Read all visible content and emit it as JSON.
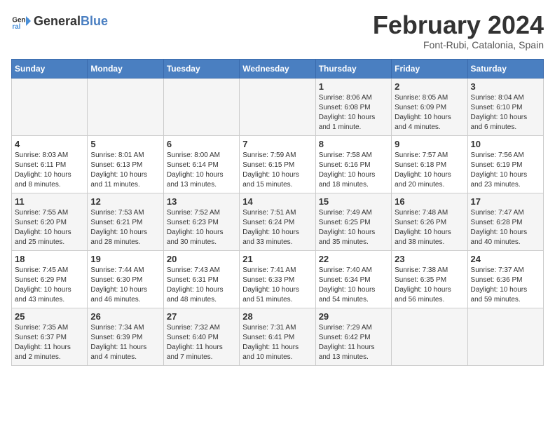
{
  "header": {
    "logo_general": "General",
    "logo_blue": "Blue",
    "title": "February 2024",
    "subtitle": "Font-Rubi, Catalonia, Spain"
  },
  "days_of_week": [
    "Sunday",
    "Monday",
    "Tuesday",
    "Wednesday",
    "Thursday",
    "Friday",
    "Saturday"
  ],
  "weeks": [
    [
      {
        "day": "",
        "detail": ""
      },
      {
        "day": "",
        "detail": ""
      },
      {
        "day": "",
        "detail": ""
      },
      {
        "day": "",
        "detail": ""
      },
      {
        "day": "1",
        "detail": "Sunrise: 8:06 AM\nSunset: 6:08 PM\nDaylight: 10 hours\nand 1 minute."
      },
      {
        "day": "2",
        "detail": "Sunrise: 8:05 AM\nSunset: 6:09 PM\nDaylight: 10 hours\nand 4 minutes."
      },
      {
        "day": "3",
        "detail": "Sunrise: 8:04 AM\nSunset: 6:10 PM\nDaylight: 10 hours\nand 6 minutes."
      }
    ],
    [
      {
        "day": "4",
        "detail": "Sunrise: 8:03 AM\nSunset: 6:11 PM\nDaylight: 10 hours\nand 8 minutes."
      },
      {
        "day": "5",
        "detail": "Sunrise: 8:01 AM\nSunset: 6:13 PM\nDaylight: 10 hours\nand 11 minutes."
      },
      {
        "day": "6",
        "detail": "Sunrise: 8:00 AM\nSunset: 6:14 PM\nDaylight: 10 hours\nand 13 minutes."
      },
      {
        "day": "7",
        "detail": "Sunrise: 7:59 AM\nSunset: 6:15 PM\nDaylight: 10 hours\nand 15 minutes."
      },
      {
        "day": "8",
        "detail": "Sunrise: 7:58 AM\nSunset: 6:16 PM\nDaylight: 10 hours\nand 18 minutes."
      },
      {
        "day": "9",
        "detail": "Sunrise: 7:57 AM\nSunset: 6:18 PM\nDaylight: 10 hours\nand 20 minutes."
      },
      {
        "day": "10",
        "detail": "Sunrise: 7:56 AM\nSunset: 6:19 PM\nDaylight: 10 hours\nand 23 minutes."
      }
    ],
    [
      {
        "day": "11",
        "detail": "Sunrise: 7:55 AM\nSunset: 6:20 PM\nDaylight: 10 hours\nand 25 minutes."
      },
      {
        "day": "12",
        "detail": "Sunrise: 7:53 AM\nSunset: 6:21 PM\nDaylight: 10 hours\nand 28 minutes."
      },
      {
        "day": "13",
        "detail": "Sunrise: 7:52 AM\nSunset: 6:23 PM\nDaylight: 10 hours\nand 30 minutes."
      },
      {
        "day": "14",
        "detail": "Sunrise: 7:51 AM\nSunset: 6:24 PM\nDaylight: 10 hours\nand 33 minutes."
      },
      {
        "day": "15",
        "detail": "Sunrise: 7:49 AM\nSunset: 6:25 PM\nDaylight: 10 hours\nand 35 minutes."
      },
      {
        "day": "16",
        "detail": "Sunrise: 7:48 AM\nSunset: 6:26 PM\nDaylight: 10 hours\nand 38 minutes."
      },
      {
        "day": "17",
        "detail": "Sunrise: 7:47 AM\nSunset: 6:28 PM\nDaylight: 10 hours\nand 40 minutes."
      }
    ],
    [
      {
        "day": "18",
        "detail": "Sunrise: 7:45 AM\nSunset: 6:29 PM\nDaylight: 10 hours\nand 43 minutes."
      },
      {
        "day": "19",
        "detail": "Sunrise: 7:44 AM\nSunset: 6:30 PM\nDaylight: 10 hours\nand 46 minutes."
      },
      {
        "day": "20",
        "detail": "Sunrise: 7:43 AM\nSunset: 6:31 PM\nDaylight: 10 hours\nand 48 minutes."
      },
      {
        "day": "21",
        "detail": "Sunrise: 7:41 AM\nSunset: 6:33 PM\nDaylight: 10 hours\nand 51 minutes."
      },
      {
        "day": "22",
        "detail": "Sunrise: 7:40 AM\nSunset: 6:34 PM\nDaylight: 10 hours\nand 54 minutes."
      },
      {
        "day": "23",
        "detail": "Sunrise: 7:38 AM\nSunset: 6:35 PM\nDaylight: 10 hours\nand 56 minutes."
      },
      {
        "day": "24",
        "detail": "Sunrise: 7:37 AM\nSunset: 6:36 PM\nDaylight: 10 hours\nand 59 minutes."
      }
    ],
    [
      {
        "day": "25",
        "detail": "Sunrise: 7:35 AM\nSunset: 6:37 PM\nDaylight: 11 hours\nand 2 minutes."
      },
      {
        "day": "26",
        "detail": "Sunrise: 7:34 AM\nSunset: 6:39 PM\nDaylight: 11 hours\nand 4 minutes."
      },
      {
        "day": "27",
        "detail": "Sunrise: 7:32 AM\nSunset: 6:40 PM\nDaylight: 11 hours\nand 7 minutes."
      },
      {
        "day": "28",
        "detail": "Sunrise: 7:31 AM\nSunset: 6:41 PM\nDaylight: 11 hours\nand 10 minutes."
      },
      {
        "day": "29",
        "detail": "Sunrise: 7:29 AM\nSunset: 6:42 PM\nDaylight: 11 hours\nand 13 minutes."
      },
      {
        "day": "",
        "detail": ""
      },
      {
        "day": "",
        "detail": ""
      }
    ]
  ]
}
